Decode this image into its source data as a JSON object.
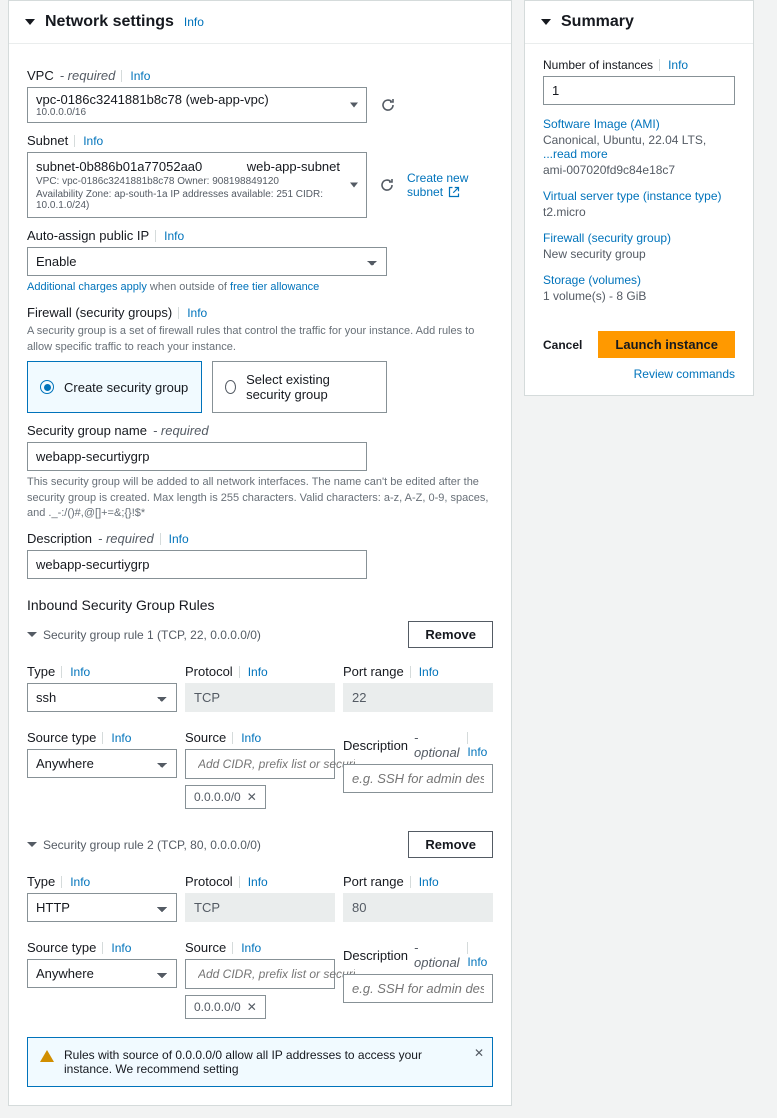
{
  "panel": {
    "title": "Network settings",
    "info": "Info"
  },
  "vpc": {
    "label": "VPC",
    "required": "- required",
    "info": "Info",
    "value": "vpc-0186c3241881b8c78 (web-app-vpc)",
    "cidr": "10.0.0.0/16"
  },
  "subnet": {
    "label": "Subnet",
    "info": "Info",
    "id": "subnet-0b886b01a77052aa0",
    "name": "web-app-subnet",
    "detail": "VPC: vpc-0186c3241881b8c78    Owner: 908198849120",
    "detail2": "Availability Zone: ap-south-1a    IP addresses available: 251    CIDR: 10.0.1.0/24)",
    "create_link": "Create new subnet"
  },
  "autoip": {
    "label": "Auto-assign public IP",
    "info": "Info",
    "value": "Enable",
    "charges": "Additional charges apply",
    "charges_mid": " when outside of ",
    "charges_link": "free tier allowance"
  },
  "firewall": {
    "label": "Firewall (security groups)",
    "info": "Info",
    "desc": "A security group is a set of firewall rules that control the traffic for your instance. Add rules to allow specific traffic to reach your instance.",
    "create": "Create security group",
    "select": "Select existing security group"
  },
  "sgname": {
    "label": "Security group name",
    "required": "- required",
    "value": "webapp-securtiygrp",
    "hint": "This security group will be added to all network interfaces. The name can't be edited after the security group is created. Max length is 255 characters. Valid characters: a-z, A-Z, 0-9, spaces, and ._-:/()#,@[]+=&;{}!$*"
  },
  "sgdesc": {
    "label": "Description",
    "required": "- required",
    "info": "Info",
    "value": "webapp-securtiygrp"
  },
  "rules": {
    "heading": "Inbound Security Group Rules",
    "remove": "Remove",
    "labels": {
      "type": "Type",
      "protocol": "Protocol",
      "port": "Port range",
      "source_type": "Source type",
      "source": "Source",
      "desc": "Description",
      "optional": "- optional",
      "info": "Info"
    },
    "source_placeholder": "Add CIDR, prefix list or security",
    "desc_placeholder": "e.g. SSH for admin desktop",
    "list": [
      {
        "title": "Security group rule 1 (TCP, 22, 0.0.0.0/0)",
        "type": "ssh",
        "protocol": "TCP",
        "port": "22",
        "source_type": "Anywhere",
        "chip": "0.0.0.0/0"
      },
      {
        "title": "Security group rule 2 (TCP, 80, 0.0.0.0/0)",
        "type": "HTTP",
        "protocol": "TCP",
        "port": "80",
        "source_type": "Anywhere",
        "chip": "0.0.0.0/0"
      }
    ]
  },
  "alert": {
    "text": "Rules with source of 0.0.0.0/0 allow all IP addresses to access your instance. We recommend setting"
  },
  "summary": {
    "title": "Summary",
    "num_label": "Number of instances",
    "num_info": "Info",
    "num_value": "1",
    "ami_label": "Software Image (AMI)",
    "ami_val1": "Canonical, Ubuntu, 22.04 LTS, ",
    "ami_read_more": "...read more",
    "ami_val2": "ami-007020fd9c84e18c7",
    "vst_label": "Virtual server type (instance type)",
    "vst_val": "t2.micro",
    "fw_label": "Firewall (security group)",
    "fw_val": "New security group",
    "st_label": "Storage (volumes)",
    "st_val": "1 volume(s) - 8 GiB",
    "cancel": "Cancel",
    "launch": "Launch instance",
    "review": "Review commands"
  }
}
